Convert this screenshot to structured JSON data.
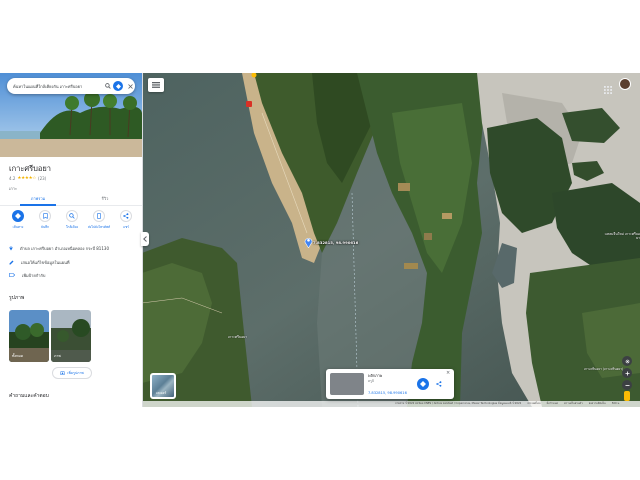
{
  "search": {
    "query": "ค้นหาในแผนที่ใกล้เคียงกัน เกาะศรีบอยา"
  },
  "place": {
    "name": "เกาะศรีบอยา",
    "rating": "4.2",
    "stars": "★★★★☆",
    "review_count": "(23)",
    "type": "เกาะ"
  },
  "tabs": {
    "overview": "ภาพรวม",
    "reviews": "รีวิว"
  },
  "actions": [
    {
      "label": "เส้นทาง",
      "icon": "directions-icon"
    },
    {
      "label": "บันทึก",
      "icon": "save-icon"
    },
    {
      "label": "ใกล้เคียง",
      "icon": "nearby-icon"
    },
    {
      "label": "ส่งไปยังโทรศัพท์",
      "icon": "send-to-phone-icon"
    },
    {
      "label": "แชร์",
      "icon": "share-icon"
    }
  ],
  "info": {
    "address": "ตำบล เกาะศรีบอยา อำเภอเหนือคลอง กระบี่ 81130",
    "suggest_edit": "เสนอให้แก้ไขข้อมูลในแผนที่",
    "add_label": "เพิ่มป้ายกำกับ"
  },
  "photos": {
    "heading": "รูปภาพ",
    "items": [
      {
        "caption": "ทั้งหมด"
      },
      {
        "caption": "ภาพ"
      }
    ],
    "add_label": "เพิ่มรูปภาพ"
  },
  "qa_heading": "คำถามและคำตอบ",
  "map": {
    "coordinate_label": "7.832815, 98.990616",
    "label_right": "แหลมจีนใหม่ เกาะศรีบอยา",
    "label_bottom": "เกาะศรีบอยา (เกาะศรีบอยา)",
    "label_side": "เกาะศรีบอยา",
    "layers_label": "เลเยอร์",
    "footer": [
      "ภาพถ่าย ©2022 Airbus CNES / Airbus Landsat / Copernicus, Maxar Technologies ข้อมูลแผนที่ ©2022",
      "ประเทศไทย",
      "ข้อกำหนด",
      "ความเป็นส่วนตัว",
      "ส่งความคิดเห็น",
      "500 ม."
    ]
  },
  "card": {
    "title": "พลิกภาพ",
    "subtitle": "ครูบี",
    "coords": "7.832815, 98.990616"
  },
  "colors": {
    "accent": "#1a73e8",
    "star": "#f4b400",
    "pin": "#4285f4"
  }
}
